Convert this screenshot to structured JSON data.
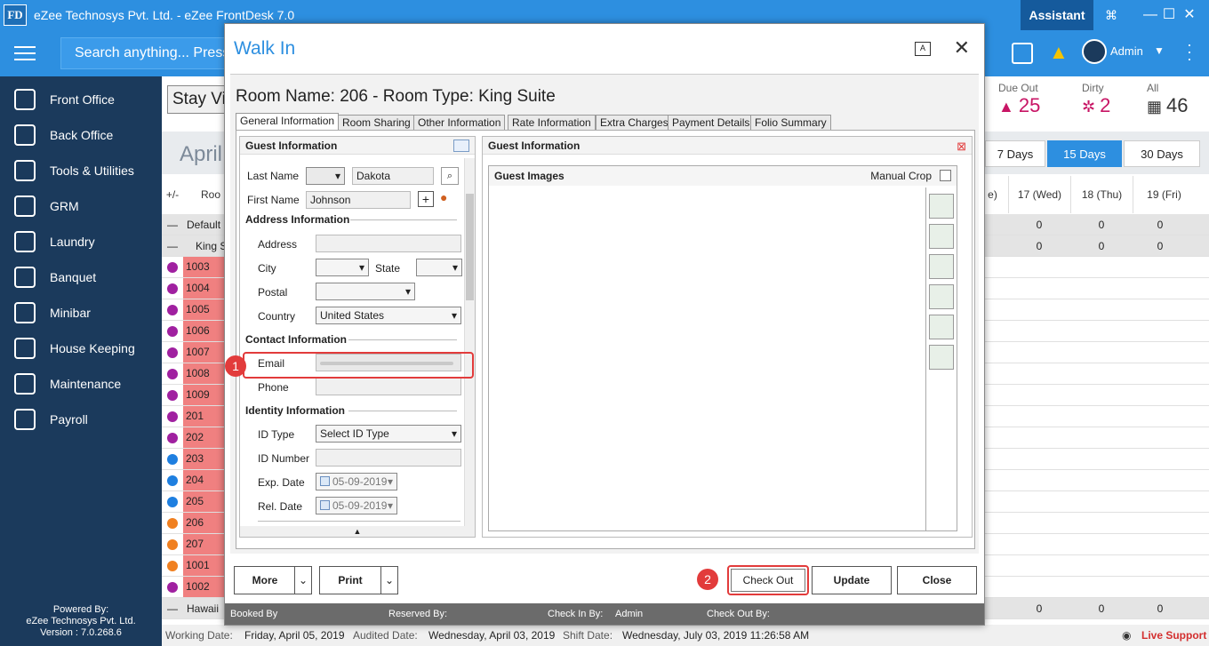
{
  "app": {
    "logo": "FD",
    "title": "eZee Technosys Pvt. Ltd. - eZee FrontDesk 7.0",
    "assistant_label": "Assistant",
    "admin_label": "Admin",
    "search_placeholder": "Search anything... Press"
  },
  "sidebar": {
    "items": [
      {
        "label": "Front Office",
        "icon": "front-office-icon"
      },
      {
        "label": "Back Office",
        "icon": "back-office-icon"
      },
      {
        "label": "Tools & Utilities",
        "icon": "tools-icon"
      },
      {
        "label": "GRM",
        "icon": "grm-icon"
      },
      {
        "label": "Laundry",
        "icon": "laundry-icon"
      },
      {
        "label": "Banquet",
        "icon": "banquet-icon"
      },
      {
        "label": "Minibar",
        "icon": "minibar-icon"
      },
      {
        "label": "House Keeping",
        "icon": "housekeeping-icon"
      },
      {
        "label": "Maintenance",
        "icon": "maintenance-icon"
      },
      {
        "label": "Payroll",
        "icon": "payroll-icon"
      }
    ],
    "powered_line1": "Powered By:",
    "powered_line2": "eZee Technosys Pvt. Ltd.",
    "version": "Version : 7.0.268.6"
  },
  "main": {
    "stay_view": "Stay Vi",
    "month": "April",
    "stats": {
      "due_out_label": "Due Out",
      "due_out_value": "25",
      "dirty_label": "Dirty",
      "dirty_value": "2",
      "all_label": "All",
      "all_value": "46"
    },
    "ranges": [
      "7 Days",
      "15 Days",
      "30 Days"
    ],
    "active_range": "15 Days",
    "col_plusminus": "+/-",
    "col_room": "Roo",
    "day_headers": [
      "e)",
      "17 (Wed)",
      "18 (Thu)",
      "19 (Fri)"
    ],
    "group_default": "Default",
    "group_king": "King S",
    "group_hawaii": "Hawaii",
    "group_values": [
      "0",
      "0",
      "0"
    ],
    "rooms": [
      {
        "no": "1003",
        "color": "#a020a0"
      },
      {
        "no": "1004",
        "color": "#a020a0"
      },
      {
        "no": "1005",
        "color": "#a020a0"
      },
      {
        "no": "1006",
        "color": "#a020a0"
      },
      {
        "no": "1007",
        "color": "#a020a0"
      },
      {
        "no": "1008",
        "color": "#a020a0"
      },
      {
        "no": "1009",
        "color": "#a020a0"
      },
      {
        "no": "201",
        "color": "#a020a0"
      },
      {
        "no": "202",
        "color": "#a020a0"
      },
      {
        "no": "203",
        "color": "#1e7fe0"
      },
      {
        "no": "204",
        "color": "#1e7fe0"
      },
      {
        "no": "205",
        "color": "#1e7fe0"
      },
      {
        "no": "206",
        "color": "#f08020"
      },
      {
        "no": "207",
        "color": "#f08020"
      },
      {
        "no": "1001",
        "color": "#f08020"
      },
      {
        "no": "1002",
        "color": "#a020a0"
      }
    ],
    "status": {
      "working_date_label": "Working Date:",
      "working_date": "Friday, April 05, 2019",
      "audited_date_label": "Audited Date:",
      "audited_date": "Wednesday, April 03, 2019",
      "shift_date_label": "Shift Date:",
      "shift_date": "Wednesday, July 03, 2019 11:26:58 AM",
      "live_support": "Live Support"
    }
  },
  "dialog": {
    "title": "Walk In",
    "room_name": "Room Name: 206 - Room Type: King Suite",
    "tabs": [
      "General Information",
      "Room Sharing",
      "Other Information",
      "Rate Information",
      "Extra Charges",
      "Payment Details",
      "Folio Summary"
    ],
    "guest_info": {
      "header": "Guest Information",
      "last_name_label": "Last Name",
      "last_name": "Dakota",
      "first_name_label": "First Name",
      "first_name": "Johnson",
      "address_section": "Address Information",
      "address_label": "Address",
      "city_label": "City",
      "state_label": "State",
      "postal_label": "Postal",
      "country_label": "Country",
      "country": "United States",
      "contact_section": "Contact Information",
      "email_label": "Email",
      "phone_label": "Phone",
      "identity_section": "Identity Information",
      "id_type_label": "ID Type",
      "id_type": "Select ID Type",
      "id_number_label": "ID Number",
      "exp_date_label": "Exp. Date",
      "exp_date": "05-09-2019",
      "rel_date_label": "Rel. Date",
      "rel_date": "05-09-2019"
    },
    "guest_images": {
      "header": "Guest Information",
      "images_label": "Guest Images",
      "manual_crop": "Manual Crop"
    },
    "buttons": {
      "more": "More",
      "print": "Print",
      "check_out": "Check Out",
      "update": "Update",
      "close": "Close"
    },
    "status": {
      "booked_by": "Booked By",
      "reserved_by": "Reserved By:",
      "check_in_by": "Check In By:",
      "check_in_by_value": "Admin",
      "check_out_by": "Check Out By:"
    },
    "callouts": [
      "1",
      "2"
    ]
  }
}
